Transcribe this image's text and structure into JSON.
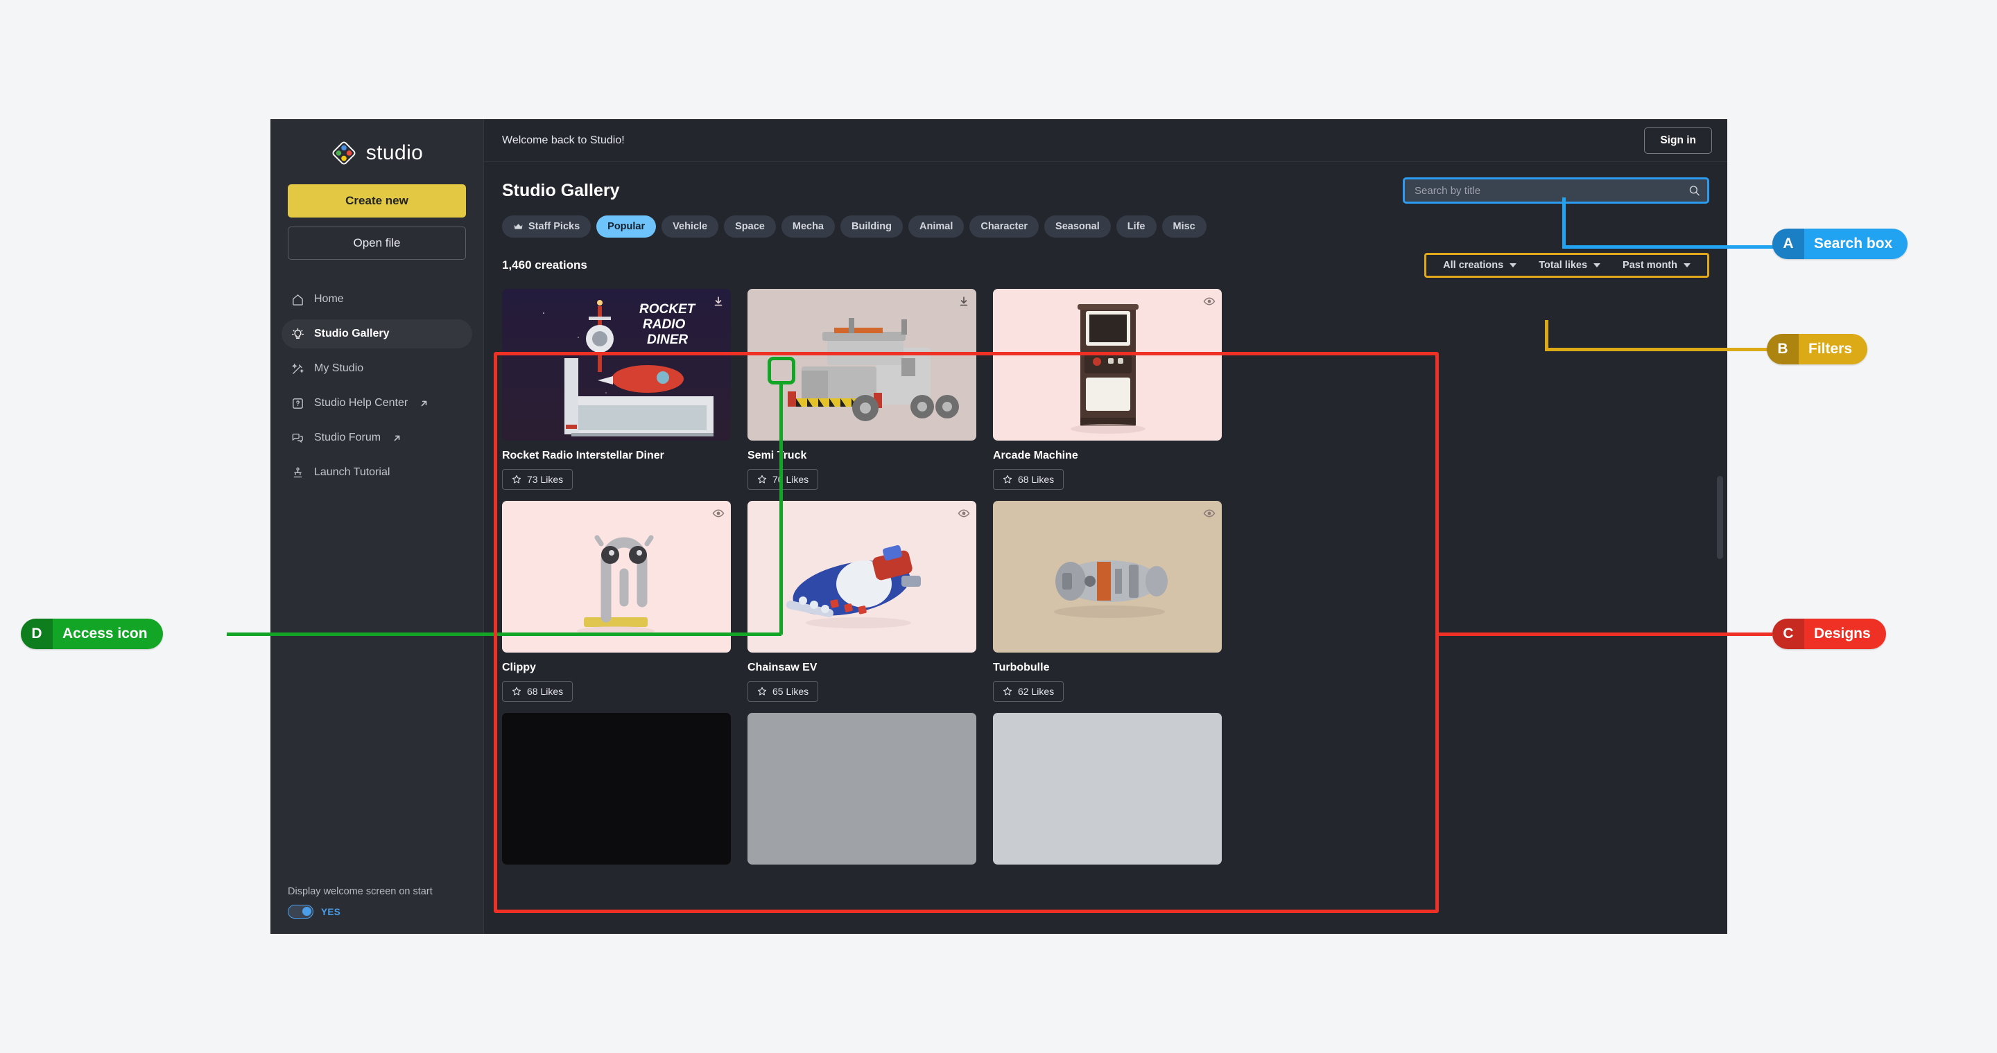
{
  "app": {
    "logo_text": "studio",
    "sidebar": {
      "create_button": "Create new",
      "open_button": "Open file",
      "items": [
        {
          "label": "Home",
          "icon": "home-icon",
          "external": false,
          "active": false
        },
        {
          "label": "Studio Gallery",
          "icon": "lightbulb-icon",
          "external": false,
          "active": true
        },
        {
          "label": "My Studio",
          "icon": "wand-icon",
          "external": false,
          "active": false
        },
        {
          "label": "Studio Help Center",
          "icon": "help-square-icon",
          "external": true,
          "active": false
        },
        {
          "label": "Studio Forum",
          "icon": "chat-bubbles-icon",
          "external": true,
          "active": false
        },
        {
          "label": "Launch Tutorial",
          "icon": "tutorial-icon",
          "external": false,
          "active": false
        }
      ],
      "footer": {
        "label": "Display welcome screen on start",
        "toggle_value": "YES",
        "toggle_on": true
      }
    },
    "topbar": {
      "welcome": "Welcome back to Studio!",
      "sign_in": "Sign in"
    },
    "gallery": {
      "title": "Studio Gallery",
      "search_placeholder": "Search by title",
      "search_value": "",
      "count_text": "1,460 creations",
      "chips": [
        {
          "label": "Staff Picks",
          "icon": "crown-icon",
          "active": false
        },
        {
          "label": "Popular",
          "icon": "",
          "active": true
        },
        {
          "label": "Vehicle",
          "icon": "",
          "active": false
        },
        {
          "label": "Space",
          "icon": "",
          "active": false
        },
        {
          "label": "Mecha",
          "icon": "",
          "active": false
        },
        {
          "label": "Building",
          "icon": "",
          "active": false
        },
        {
          "label": "Animal",
          "icon": "",
          "active": false
        },
        {
          "label": "Character",
          "icon": "",
          "active": false
        },
        {
          "label": "Seasonal",
          "icon": "",
          "active": false
        },
        {
          "label": "Life",
          "icon": "",
          "active": false
        },
        {
          "label": "Misc",
          "icon": "",
          "active": false
        }
      ],
      "filters": [
        {
          "label": "All creations"
        },
        {
          "label": "Total likes"
        },
        {
          "label": "Past month"
        }
      ],
      "cards": [
        {
          "title": "Rocket Radio Interstellar Diner",
          "likes": "73 Likes",
          "icon": "download-icon",
          "thumb": "rocket-radio-diner"
        },
        {
          "title": "Semi Truck",
          "likes": "70 Likes",
          "icon": "download-icon",
          "thumb": "semi-truck"
        },
        {
          "title": "Arcade Machine",
          "likes": "68 Likes",
          "icon": "eye-icon",
          "thumb": "arcade-machine"
        },
        {
          "title": "Clippy",
          "likes": "68 Likes",
          "icon": "eye-icon",
          "thumb": "clippy"
        },
        {
          "title": "Chainsaw EV",
          "likes": "65 Likes",
          "icon": "eye-icon",
          "thumb": "chainsaw-ev"
        },
        {
          "title": "Turbobulle",
          "likes": "62 Likes",
          "icon": "eye-icon",
          "thumb": "turbobulle"
        }
      ]
    }
  },
  "annotations": [
    {
      "letter": "A",
      "label": "Search box",
      "color": "#22a3f1"
    },
    {
      "letter": "B",
      "label": "Filters",
      "color": "#ddaa17"
    },
    {
      "letter": "C",
      "label": "Designs",
      "color": "#ee3124"
    },
    {
      "letter": "D",
      "label": "Access icon",
      "color": "#12a526"
    }
  ]
}
